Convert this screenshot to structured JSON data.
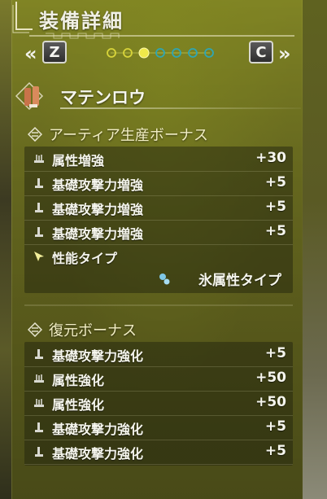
{
  "title": "装備詳細",
  "nav": {
    "left_key": "Z",
    "right_key": "C",
    "left_arrow": "«",
    "right_arrow": "»",
    "page_count": 7,
    "current_page": 3
  },
  "weapon": {
    "name": "マテンロウ",
    "icon": "lance-weapon-icon"
  },
  "artian_section": {
    "heading": "アーティア生産ボーナス",
    "rows": [
      {
        "icon": "element-boost-icon",
        "label": "属性増強",
        "value": "+30"
      },
      {
        "icon": "attack-boost-icon",
        "label": "基礎攻撃力増強",
        "value": "+5"
      },
      {
        "icon": "attack-boost-icon",
        "label": "基礎攻撃力増強",
        "value": "+5"
      },
      {
        "icon": "attack-boost-icon",
        "label": "基礎攻撃力増強",
        "value": "+5"
      }
    ],
    "performance": {
      "icon": "performance-type-icon",
      "label": "性能タイプ",
      "value_icon": "ice-element-icon",
      "value": "氷属性タイプ"
    }
  },
  "restore_section": {
    "heading": "復元ボーナス",
    "rows": [
      {
        "icon": "attack-boost-icon",
        "label": "基礎攻撃力強化",
        "value": "+5"
      },
      {
        "icon": "element-boost-icon",
        "label": "属性強化",
        "value": "+50"
      },
      {
        "icon": "element-boost-icon",
        "label": "属性強化",
        "value": "+50"
      },
      {
        "icon": "attack-boost-icon",
        "label": "基礎攻撃力強化",
        "value": "+5"
      },
      {
        "icon": "attack-boost-icon",
        "label": "基礎攻撃力強化",
        "value": "+5"
      }
    ]
  },
  "colors": {
    "text": "#f6f6ee",
    "heading": "#f2eec4",
    "dot_filled": "#f0e94a",
    "dot_teal": "#2fa6b4"
  }
}
